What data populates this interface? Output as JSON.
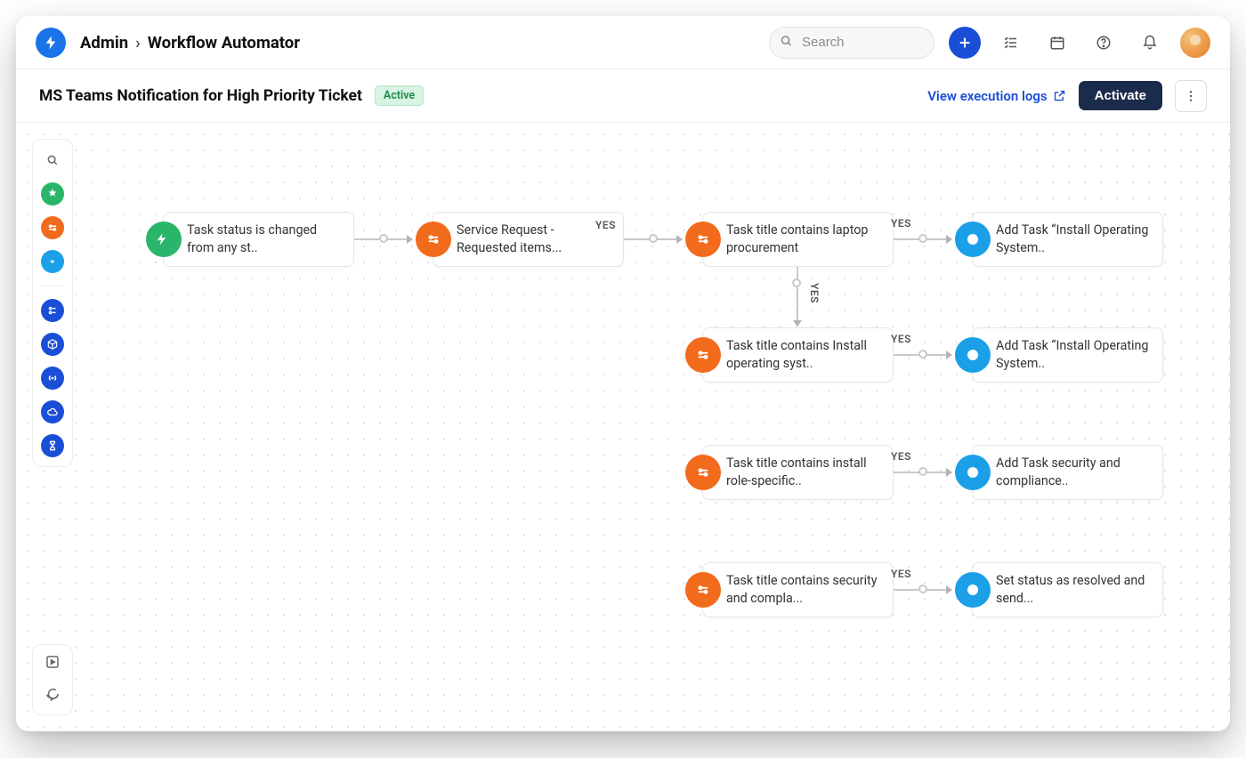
{
  "breadcrumb": {
    "root": "Admin",
    "current": "Workflow Automator"
  },
  "search": {
    "placeholder": "Search"
  },
  "page": {
    "title": "MS Teams Notification for High Priority Ticket",
    "status": "Active",
    "view_logs": "View execution logs",
    "activate": "Activate"
  },
  "tool_rail": {
    "icons": [
      "search",
      "trigger",
      "condition",
      "action",
      "divider",
      "form",
      "cube",
      "code",
      "cloud",
      "timer"
    ]
  },
  "edge_labels": {
    "yes": "YES"
  },
  "workflow": {
    "trigger": {
      "text": "Task status is changed from any st.."
    },
    "cond_service_request": {
      "text": "Service Request - Requested items..."
    },
    "cond_laptop": {
      "text": "Task title contains laptop procurement"
    },
    "action_install_os_1": {
      "text": "Add Task “Install Operating System.."
    },
    "cond_install_os": {
      "text": "Task title contains Install operating syst.."
    },
    "action_install_os_2": {
      "text": "Add Task “Install Operating System.."
    },
    "cond_role_specific": {
      "text": "Task title contains install role-specific.."
    },
    "action_security": {
      "text": "Add Task security and compliance.."
    },
    "cond_security": {
      "text": "Task title contains security and compla..."
    },
    "action_resolved": {
      "text": "Set status as resolved and send..."
    }
  }
}
